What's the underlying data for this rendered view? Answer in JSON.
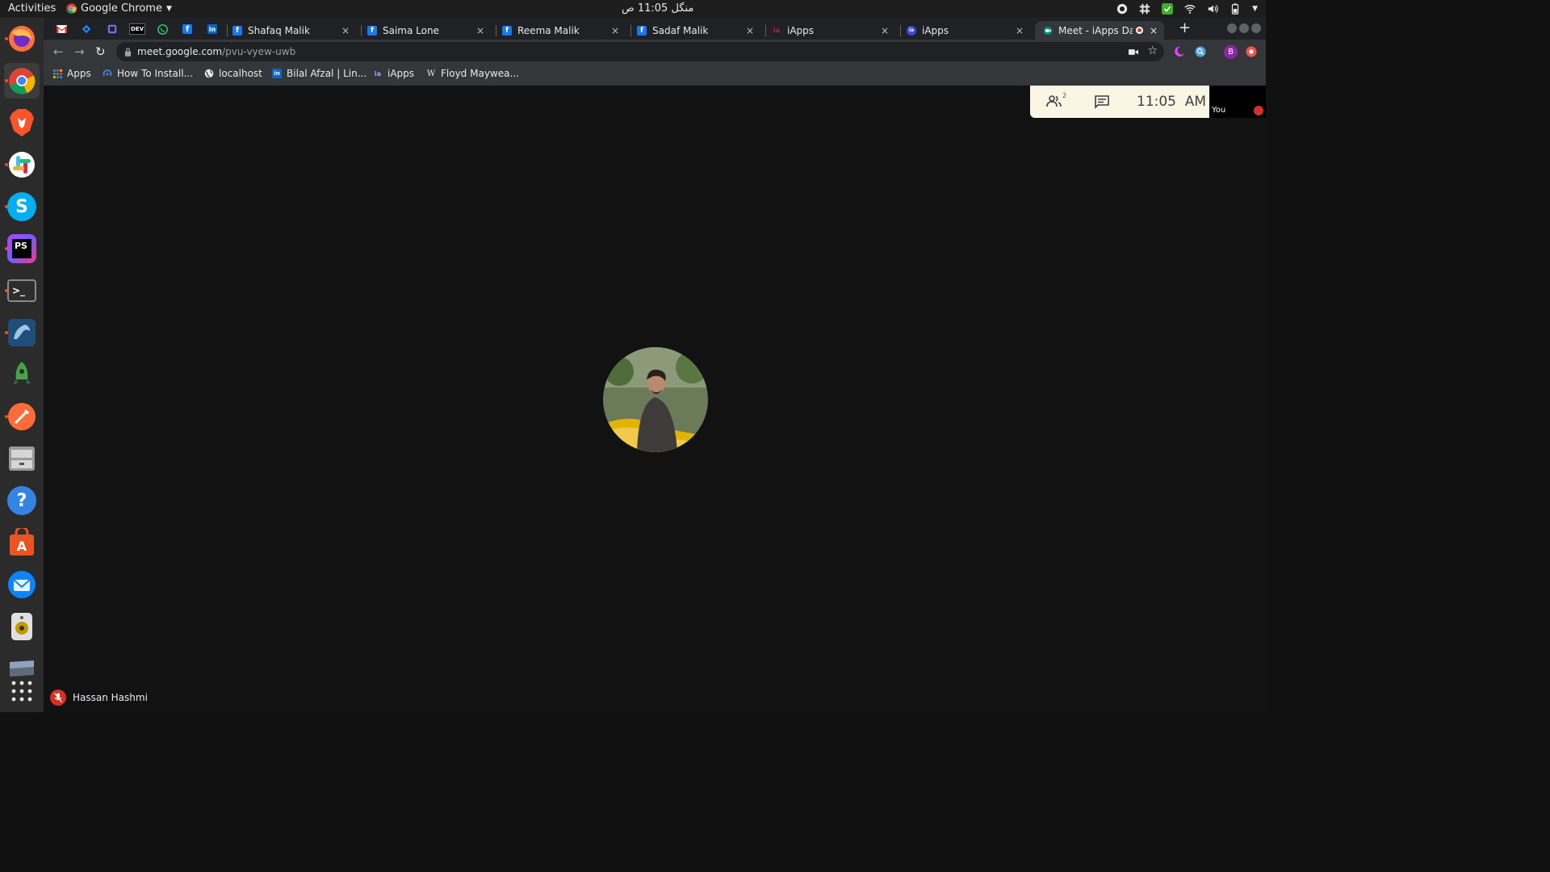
{
  "topbar": {
    "activities": "Activities",
    "app_name": "Google Chrome",
    "clock": "منگل 11:05 ص"
  },
  "dock": {
    "items": [
      {
        "name": "firefox",
        "color": "#ff7139"
      },
      {
        "name": "chrome",
        "color": "#4285f4"
      },
      {
        "name": "brave",
        "color": "#fb542b"
      },
      {
        "name": "slack",
        "color": "#ffffff"
      },
      {
        "name": "skype",
        "color": "#00aff0"
      },
      {
        "name": "phpstorm",
        "color": "#b345f1"
      },
      {
        "name": "terminal",
        "color": "#300a24"
      },
      {
        "name": "mysql-workbench",
        "color": "#2b5f8f"
      },
      {
        "name": "robo3t",
        "color": "#2c2c2c"
      },
      {
        "name": "postman",
        "color": "#ff6c37"
      },
      {
        "name": "files-archive",
        "color": "#8a8a8a"
      },
      {
        "name": "help",
        "color": "#3584e4"
      },
      {
        "name": "software-center",
        "color": "#e95420"
      },
      {
        "name": "thunderbird",
        "color": "#0a84ff"
      },
      {
        "name": "rhythmbox",
        "color": "#d0d0d0"
      },
      {
        "name": "desktop",
        "color": "#5f6b7a"
      }
    ],
    "apps_grid_label": "Show Applications"
  },
  "tabs": {
    "pinned": [
      "gmail",
      "jira",
      "clickup",
      "dev",
      "whatsapp",
      "facebook",
      "linkedin"
    ],
    "pinned_labels": {
      "dev": "DEV",
      "linkedin": "in",
      "facebook": "f"
    },
    "items": [
      {
        "title": "Shafaq Malik",
        "icon": "facebook-icon",
        "fav": "f",
        "color": "#1877f2"
      },
      {
        "title": "Saima Lone",
        "icon": "facebook-icon",
        "fav": "f",
        "color": "#1877f2"
      },
      {
        "title": "Reema Malik",
        "icon": "facebook-icon",
        "fav": "f",
        "color": "#1877f2"
      },
      {
        "title": "Sadaf Malik",
        "icon": "facebook-icon",
        "fav": "f",
        "color": "#1877f2"
      },
      {
        "title": "iApps",
        "icon": "iapps-icon",
        "fav": "ia",
        "color": "#c2185b"
      },
      {
        "title": "iApps",
        "icon": "iapps-icon",
        "fav": "ia",
        "color": "#3b4bd8"
      },
      {
        "title": "Meet - iApps Daily",
        "icon": "meet-icon",
        "fav": "",
        "color": "#00897b",
        "active": true
      }
    ],
    "close_glyph": "×",
    "new_tab_glyph": "+"
  },
  "toolbar": {
    "url_host": "meet.google.com",
    "url_path": "/pvu-vyew-uwb"
  },
  "bookmarks": [
    {
      "label": "Apps",
      "icon": "apps-grid-icon",
      "fav": "⋮⋮"
    },
    {
      "label": "How To Install...",
      "icon": "bookmark-site-icon",
      "fav": "◎"
    },
    {
      "label": "localhost",
      "icon": "globe-icon",
      "fav": "◉"
    },
    {
      "label": "Bilal Afzal | Lin...",
      "icon": "linkedin-icon",
      "fav": "in"
    },
    {
      "label": "iApps",
      "icon": "iapps-icon",
      "fav": "ia"
    },
    {
      "label": "Floyd Maywea...",
      "icon": "wikipedia-icon",
      "fav": "W"
    }
  ],
  "meet": {
    "participant_count": "2",
    "time": "11:05  AM",
    "self_label": "You",
    "presenter_name": "Hassan Hashmi"
  }
}
